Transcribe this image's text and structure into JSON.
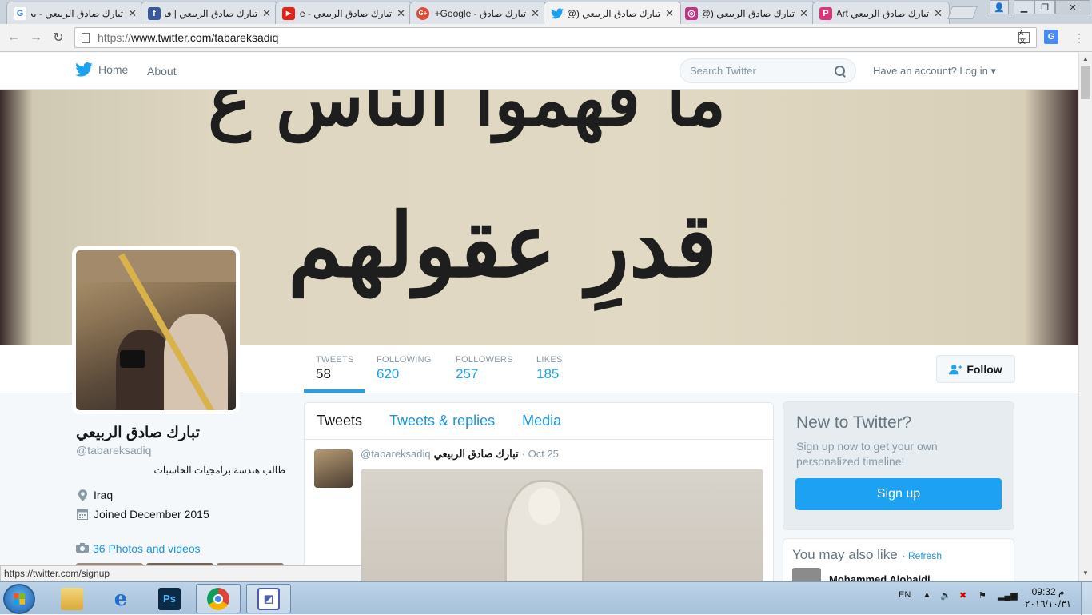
{
  "browser": {
    "tabs": [
      {
        "title": "تبارك صادق الربيعي - بحث",
        "favicon": "G",
        "color": "#4285f4"
      },
      {
        "title": "تبارك صادق الربيعي | فيسبوك",
        "favicon": "f",
        "color": "#3b5998"
      },
      {
        "title": "تبارك صادق الربيعي - YouTube",
        "favicon": "▶",
        "color": "#e62117"
      },
      {
        "title": "تبارك صادق - Google+",
        "favicon": "G+",
        "color": "#dd4b39"
      },
      {
        "title": "تبارك صادق الربيعي (@",
        "favicon": "t",
        "color": "#1da1f2"
      },
      {
        "title": "تبارك صادق الربيعي (@",
        "favicon": "◎",
        "color": "#c13584"
      },
      {
        "title": "تبارك صادق الربيعي Art",
        "favicon": "P",
        "color": "#d9367a"
      }
    ],
    "url_proto": "https://",
    "url_rest": "www.twitter.com/tabareksadiq"
  },
  "twitter_nav": {
    "home": "Home",
    "about": "About",
    "search_placeholder": "Search Twitter",
    "login_prefix": "Have an account?",
    "login": "Log in"
  },
  "stats": [
    {
      "label": "TWEETS",
      "value": "58"
    },
    {
      "label": "FOLLOWING",
      "value": "620"
    },
    {
      "label": "FOLLOWERS",
      "value": "257"
    },
    {
      "label": "LIKES",
      "value": "185"
    }
  ],
  "follow_label": "Follow",
  "profile": {
    "name": "تبارك صادق الربيعي",
    "handle": "@tabareksadiq",
    "bio": "طالب هندسة برامجيات الحاسبات",
    "location": "Iraq",
    "joined": "Joined December 2015",
    "photos": "36 Photos and videos"
  },
  "timeline": {
    "tabs": [
      "Tweets",
      "Tweets & replies",
      "Media"
    ],
    "tweet": {
      "name": "تبارك صادق الربيعي",
      "handle": "@tabareksadiq",
      "date": "· Oct 25"
    }
  },
  "signup_card": {
    "title": "New to Twitter?",
    "text": "Sign up now to get your own personalized timeline!",
    "button": "Sign up"
  },
  "suggest": {
    "title": "You may also like",
    "refresh": "· Refresh",
    "first_user": "Mohammed Alobaidi"
  },
  "status_url": "https://twitter.com/signup",
  "taskbar": {
    "lang": "EN",
    "time": "09:32 م",
    "date": "٢٠١٦/١٠/٣١"
  },
  "banner_text": {
    "line1": "ما فهموا الناس ع",
    "line2": "قدرِ عقولهم"
  },
  "colors": {
    "twitter_blue": "#1da1f2",
    "link_blue": "#1b95e0"
  }
}
